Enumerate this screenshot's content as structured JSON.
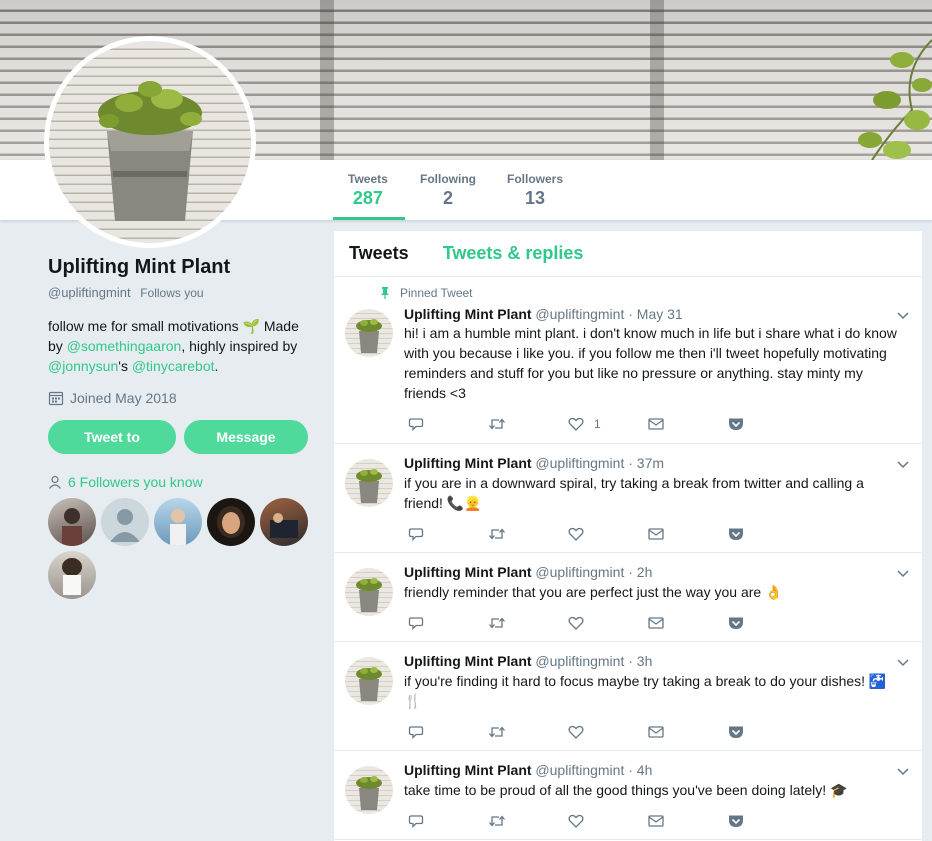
{
  "profile": {
    "name": "Uplifting Mint Plant",
    "handle": "@upliftingmint",
    "follows_you": "Follows you",
    "bio_part1": "follow me for small motivations ",
    "bio_part2": " Made by ",
    "bio_link1": "@somethingaaron",
    "bio_part3": ", highly inspired by ",
    "bio_link2": "@jonnysun",
    "bio_part4": "'s ",
    "bio_link3": "@tinycarebot",
    "bio_part5": ".",
    "joined": "Joined May 2018",
    "tweet_to_label": "Tweet to",
    "message_label": "Message",
    "followers_you_know": "6 Followers you know"
  },
  "stats": [
    {
      "label": "Tweets",
      "value": "287"
    },
    {
      "label": "Following",
      "value": "2"
    },
    {
      "label": "Followers",
      "value": "13"
    }
  ],
  "tabs": [
    {
      "label": "Tweets"
    },
    {
      "label": "Tweets & replies"
    }
  ],
  "tweets": [
    {
      "pinned_label": "Pinned Tweet",
      "name": "Uplifting Mint Plant",
      "meta": "@upliftingmint · May 31",
      "lines": [
        "hi! i am a humble mint plant. i don't know much in life but i share what i do know",
        "with you because i like you. if you follow me then i'll tweet hopefully motivating",
        "reminders and stuff for you but like no pressure or anything. stay minty my",
        "friends <3"
      ],
      "like_count": "1"
    },
    {
      "name": "Uplifting Mint Plant",
      "meta": "@upliftingmint · 37m",
      "lines": [
        "if you are in a downward spiral, try taking a break from twitter and calling a",
        "friend! 📞👱"
      ]
    },
    {
      "name": "Uplifting Mint Plant",
      "meta": "@upliftingmint · 2h",
      "lines": [
        "friendly reminder that you are perfect just the way you are 👌"
      ]
    },
    {
      "name": "Uplifting Mint Plant",
      "meta": "@upliftingmint · 3h",
      "lines": [
        "if you're finding it hard to focus maybe try taking a break to do your dishes! 🚰",
        "🍴"
      ]
    },
    {
      "name": "Uplifting Mint Plant",
      "meta": "@upliftingmint · 4h",
      "lines": [
        "take time to be proud of all the good things you've been doing lately! 🎓"
      ]
    }
  ],
  "icons": {
    "bio_emoji": "seedling-icon",
    "joined": "calendar-icon",
    "followers": "person-icon",
    "pin": "pin-icon",
    "reply": "reply-icon",
    "retweet": "retweet-icon",
    "like": "heart-icon",
    "dm": "envelope-icon",
    "save": "pocket-icon",
    "more": "chevron-down-icon"
  },
  "colors": {
    "accent": "#2fc98a",
    "button": "#4fd99a",
    "muted": "#657786",
    "background": "#e6ecf0"
  }
}
